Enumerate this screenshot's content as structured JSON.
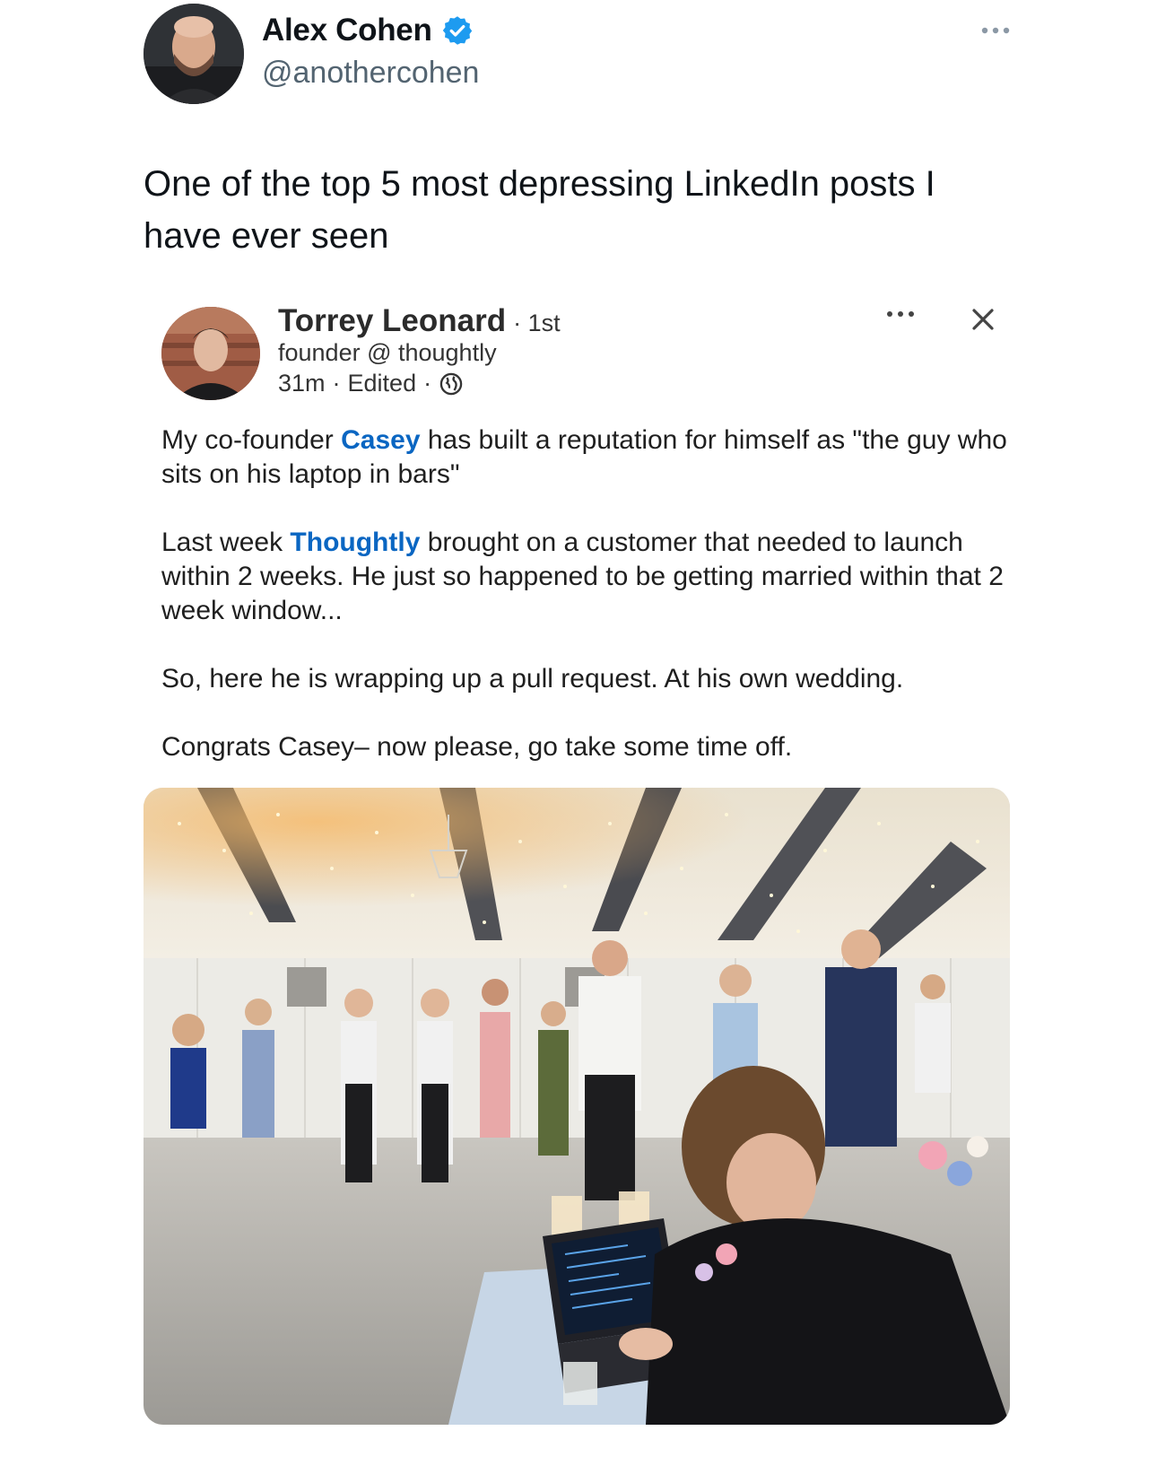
{
  "tweet": {
    "author_name": "Alex Cohen",
    "author_handle": "@anothercohen",
    "text": "One of the top 5 most depressing LinkedIn posts I have ever seen",
    "icons": {
      "verified": "verified-badge-icon",
      "more": "more-options-icon"
    },
    "colors": {
      "verified": "#1d9bf0",
      "secondary_text": "#536471"
    }
  },
  "linkedin_post": {
    "author_name": "Torrey Leonard",
    "degree": "1st",
    "headline": "founder @ thoughtly",
    "time": "31m",
    "edited": "Edited",
    "body": {
      "p1_before": "My co-founder ",
      "p1_link": "Casey",
      "p1_after": " has built a reputation for himself as \"the guy who sits on his laptop in bars\"",
      "p2_before": "Last week ",
      "p2_link": "Thoughtly",
      "p2_after": " brought on a customer that needed to launch within 2 weeks. He just so happened to be getting married within that 2 week window...",
      "p3": "So, here he is wrapping up a pull request. At his own wedding.",
      "p4": "Congrats Casey– now please, go take some time off."
    },
    "icons": {
      "globe": "globe-icon",
      "more": "more-options-icon",
      "close": "close-icon"
    },
    "colors": {
      "link": "#0a66c2"
    }
  }
}
